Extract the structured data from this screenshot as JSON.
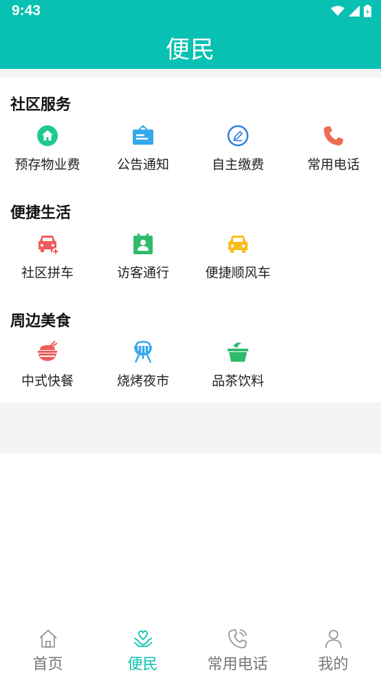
{
  "status": {
    "time": "9:43"
  },
  "header": {
    "title": "便民"
  },
  "sections": [
    {
      "title": "社区服务",
      "items": [
        {
          "label": "预存物业费",
          "icon": "house-icon"
        },
        {
          "label": "公告通知",
          "icon": "notice-board-icon"
        },
        {
          "label": "自主缴费",
          "icon": "pencil-circle-icon"
        },
        {
          "label": "常用电话",
          "icon": "phone-icon"
        }
      ]
    },
    {
      "title": "便捷生活",
      "items": [
        {
          "label": "社区拼车",
          "icon": "carpool-icon"
        },
        {
          "label": "访客通行",
          "icon": "visitor-pass-icon"
        },
        {
          "label": "便捷顺风车",
          "icon": "taxi-icon"
        }
      ]
    },
    {
      "title": "周边美食",
      "items": [
        {
          "label": "中式快餐",
          "icon": "rice-bowl-icon"
        },
        {
          "label": "烧烤夜市",
          "icon": "bbq-grill-icon"
        },
        {
          "label": "品茶饮料",
          "icon": "tea-cup-icon"
        }
      ]
    }
  ],
  "tabbar": {
    "tabs": [
      {
        "label": "首页",
        "icon": "home-outline-icon",
        "active": false
      },
      {
        "label": "便民",
        "icon": "heart-hands-icon",
        "active": true
      },
      {
        "label": "常用电话",
        "icon": "phone-outline-icon",
        "active": false
      },
      {
        "label": "我的",
        "icon": "person-outline-icon",
        "active": false
      }
    ]
  },
  "colors": {
    "accent": "#08c1b2",
    "tab_inactive": "#777777",
    "section_bg_gap": "#f4f4f4"
  }
}
